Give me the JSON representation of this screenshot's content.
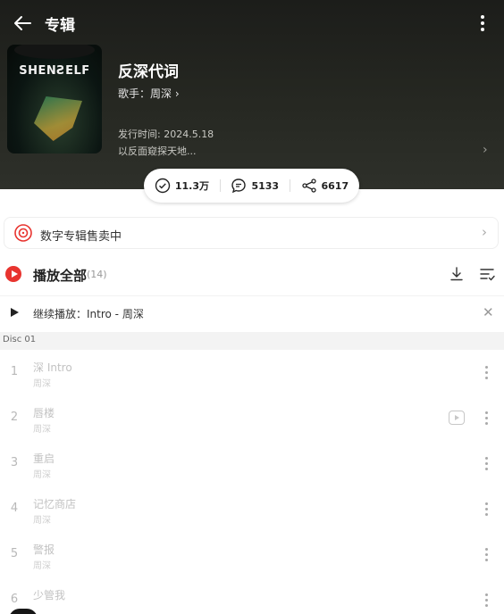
{
  "header": {
    "title": "专辑"
  },
  "album": {
    "cover_logo": "SHENƧELF",
    "name": "反深代词",
    "artist_label": "歌手：周深",
    "release": "发行时间: 2024.5.18",
    "description": "以反面窥探天地..."
  },
  "stats": {
    "collect": "11.3万",
    "comments": "5133",
    "shares": "6617"
  },
  "banner": {
    "text": "数字专辑售卖中"
  },
  "playall": {
    "label": "播放全部",
    "count": "(14)"
  },
  "continue_play": {
    "label": "继续播放：Intro - 周深"
  },
  "disc": {
    "label": "Disc 01"
  },
  "tracks": [
    {
      "num": "1",
      "title": "深 Intro",
      "artist": "周深",
      "mv": false
    },
    {
      "num": "2",
      "title": "唇楼",
      "artist": "周深",
      "mv": true
    },
    {
      "num": "3",
      "title": "重启",
      "artist": "周深",
      "mv": false
    },
    {
      "num": "4",
      "title": "记忆商店",
      "artist": "周深",
      "mv": false
    },
    {
      "num": "5",
      "title": "警报",
      "artist": "周深",
      "mv": false
    },
    {
      "num": "6",
      "title": "少管我",
      "artist": "",
      "mv": false
    }
  ],
  "colors": {
    "accent": "#e8342f",
    "hero_bg": "#262822"
  }
}
